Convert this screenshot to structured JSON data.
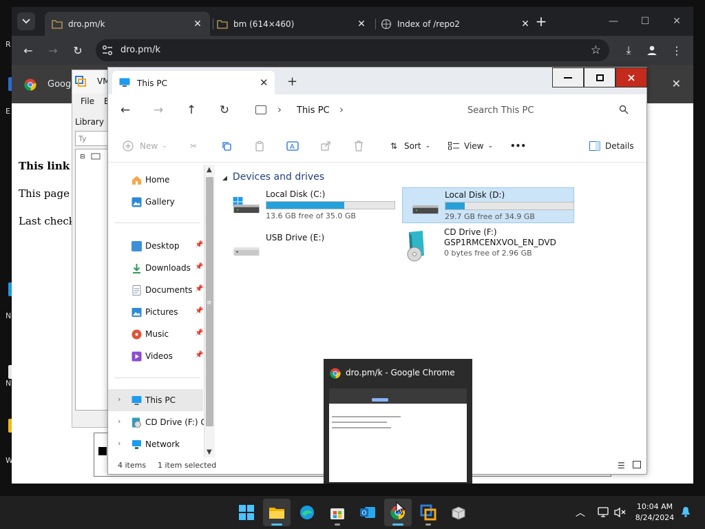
{
  "chrome": {
    "tabs": [
      {
        "label": "dro.pm/k",
        "active": true
      },
      {
        "label": "bm (614×460)",
        "active": false
      },
      {
        "label": "Index of /repo2",
        "active": false
      }
    ],
    "new_tab": "+",
    "url": "dro.pm/k",
    "infobar_text": "Goog",
    "page_lines": [
      {
        "text": "This link e",
        "bold": true
      },
      {
        "text": "This page a",
        "bold": false
      },
      {
        "text": "Last check:",
        "bold": false
      }
    ]
  },
  "vm_app": {
    "title": "VM",
    "menu": [
      "File",
      "E"
    ],
    "library_label": "Library",
    "search_placeholder": "Ty"
  },
  "explorer": {
    "tab_title": "This PC",
    "breadcrumb": "This PC",
    "search_placeholder": "Search This PC",
    "commands": {
      "new": "New",
      "sort": "Sort",
      "view": "View",
      "more": "•••",
      "details": "Details"
    },
    "sidebar": {
      "top": [
        {
          "label": "Home",
          "icon": "home-icon"
        },
        {
          "label": "Gallery",
          "icon": "gallery-icon"
        }
      ],
      "quick_access": [
        {
          "label": "Desktop",
          "icon": "desktop-folder-icon",
          "color": "#3d8fd8"
        },
        {
          "label": "Downloads",
          "icon": "downloads-icon",
          "color": "#2aa052"
        },
        {
          "label": "Documents",
          "icon": "documents-icon",
          "color": "#8a8fa0"
        },
        {
          "label": "Pictures",
          "icon": "pictures-icon",
          "color": "#2f8bd6"
        },
        {
          "label": "Music",
          "icon": "music-icon",
          "color": "#e0533a"
        },
        {
          "label": "Videos",
          "icon": "videos-icon",
          "color": "#8b4bd6"
        }
      ],
      "locations": [
        {
          "label": "This PC",
          "icon": "this-pc-icon",
          "selected": true
        },
        {
          "label": "CD Drive (F:) GS",
          "icon": "cd-drive-icon",
          "selected": false
        },
        {
          "label": "Network",
          "icon": "network-icon",
          "selected": false
        }
      ]
    },
    "group_header": "Devices and drives",
    "drives": [
      {
        "name": "Local Disk (C:)",
        "free_text": "13.6 GB free of 35.0 GB",
        "used_fraction": 0.61,
        "selected": false,
        "kind": "system"
      },
      {
        "name": "Local Disk (D:)",
        "free_text": "29.7 GB free of 34.9 GB",
        "used_fraction": 0.15,
        "selected": true,
        "kind": "disk"
      },
      {
        "name": "USB Drive (E:)",
        "free_text": "",
        "used_fraction": null,
        "selected": false,
        "kind": "usb"
      },
      {
        "name": "CD Drive (F:)",
        "sub": "GSP1RMCENXVOL_EN_DVD",
        "free_text": "0 bytes free of 2.96 GB",
        "used_fraction": null,
        "selected": false,
        "kind": "cd"
      }
    ],
    "status": {
      "items": "4 items",
      "selected": "1 item selected"
    }
  },
  "preview": {
    "title": "dro.pm/k - Google Chrome"
  },
  "taskbar": {
    "apps": [
      "start",
      "file-explorer",
      "edge",
      "store",
      "outlook",
      "chrome",
      "vmware",
      "app"
    ],
    "time": "10:04 AM",
    "date": "8/24/2024"
  },
  "colors": {
    "accent": "#26a0da",
    "selection": "#cce4f7",
    "close_red": "#c42b1c"
  }
}
